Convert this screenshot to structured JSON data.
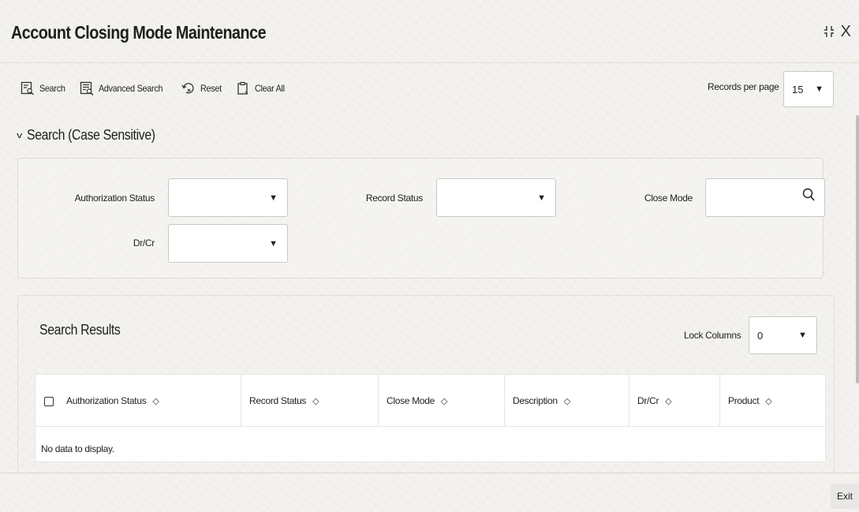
{
  "header": {
    "title": "Account Closing Mode Maintenance",
    "close_glyph": "X"
  },
  "toolbar": {
    "search": "Search",
    "advanced_search": "Advanced Search",
    "reset": "Reset",
    "clear_all": "Clear All",
    "records_per_page_label": "Records per page",
    "records_per_page_value": "15"
  },
  "search_section": {
    "toggle_label": "Search (Case Sensitive)",
    "fields": {
      "authorization_status": {
        "label": "Authorization Status",
        "value": ""
      },
      "record_status": {
        "label": "Record Status",
        "value": ""
      },
      "close_mode": {
        "label": "Close Mode",
        "value": ""
      },
      "dr_cr": {
        "label": "Dr/Cr",
        "value": ""
      }
    }
  },
  "results": {
    "title": "Search Results",
    "lock_columns_label": "Lock Columns",
    "lock_columns_value": "0",
    "columns": [
      "Authorization Status",
      "Record Status",
      "Close Mode",
      "Description",
      "Dr/Cr",
      "Product"
    ],
    "empty_message": "No data to display."
  },
  "footer": {
    "exit_label": "Exit"
  },
  "icons": {
    "collapse": "collapse-arrows-icon",
    "search": "search-list-icon",
    "advanced_search": "advanced-search-icon",
    "reset": "reset-icon",
    "clear_all": "clipboard-icon",
    "lookup": "magnifier-icon",
    "dropdown": "caret-down-icon",
    "sort": "sort-updown-icon"
  }
}
